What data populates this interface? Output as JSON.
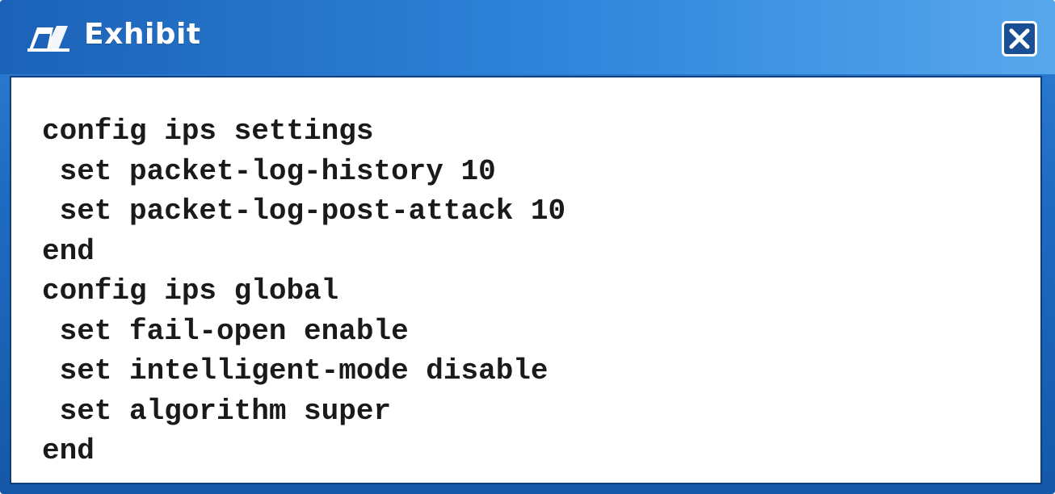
{
  "window": {
    "title": "Exhibit",
    "close_icon": "close-icon"
  },
  "colors": {
    "titlebar_start": "#1b62b8",
    "titlebar_end": "#57a7ec",
    "content_bg": "#ffffff",
    "text": "#1a1a1a"
  },
  "code": {
    "lines": [
      "config ips settings",
      " set packet-log-history 10",
      " set packet-log-post-attack 10",
      "end",
      "config ips global",
      " set fail-open enable",
      " set intelligent-mode disable",
      " set algorithm super",
      "end"
    ]
  }
}
